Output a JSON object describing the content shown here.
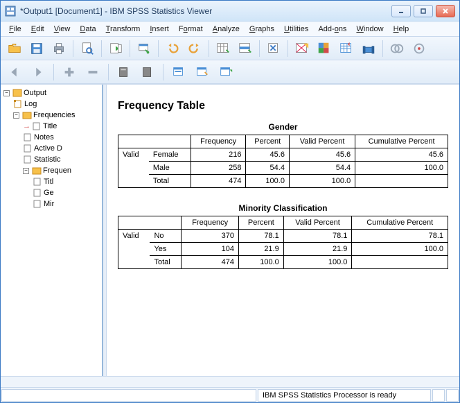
{
  "window": {
    "title": "*Output1 [Document1] - IBM SPSS Statistics Viewer"
  },
  "menu": [
    "File",
    "Edit",
    "View",
    "Data",
    "Transform",
    "Insert",
    "Format",
    "Analyze",
    "Graphs",
    "Utilities",
    "Add-ons",
    "Window",
    "Help"
  ],
  "toolbar1": [
    "open",
    "save",
    "print",
    "preview",
    "export",
    "recall",
    "undo",
    "redo",
    "goto-case",
    "goto-var",
    "variables",
    "find",
    "chart",
    "chart2",
    "weight",
    "select",
    "split",
    "value-labels"
  ],
  "toolbar2": [
    "back",
    "forward",
    "add",
    "remove",
    "collapse",
    "expand",
    "show",
    "hide",
    "pane1",
    "pane2",
    "pane3"
  ],
  "outline": {
    "root": "Output",
    "items": [
      {
        "label": "Log"
      },
      {
        "label": "Frequencies",
        "children": [
          {
            "label": "Title",
            "active": true
          },
          {
            "label": "Notes"
          },
          {
            "label": "Active Dataset"
          },
          {
            "label": "Statistics"
          },
          {
            "label": "Frequency Table",
            "children": [
              {
                "label": "Title"
              },
              {
                "label": "Gender"
              },
              {
                "label": "Minority Classification"
              }
            ]
          }
        ]
      }
    ]
  },
  "content": {
    "heading": "Frequency Table",
    "tables": [
      {
        "title": "Gender",
        "columns": [
          "Frequency",
          "Percent",
          "Valid Percent",
          "Cumulative Percent"
        ],
        "group": "Valid",
        "rows": [
          {
            "label": "Female",
            "cells": [
              "216",
              "45.6",
              "45.6",
              "45.6"
            ]
          },
          {
            "label": "Male",
            "cells": [
              "258",
              "54.4",
              "54.4",
              "100.0"
            ]
          },
          {
            "label": "Total",
            "cells": [
              "474",
              "100.0",
              "100.0",
              ""
            ]
          }
        ]
      },
      {
        "title": "Minority Classification",
        "columns": [
          "Frequency",
          "Percent",
          "Valid Percent",
          "Cumulative Percent"
        ],
        "group": "Valid",
        "rows": [
          {
            "label": "No",
            "cells": [
              "370",
              "78.1",
              "78.1",
              "78.1"
            ]
          },
          {
            "label": "Yes",
            "cells": [
              "104",
              "21.9",
              "21.9",
              "100.0"
            ]
          },
          {
            "label": "Total",
            "cells": [
              "474",
              "100.0",
              "100.0",
              ""
            ]
          }
        ]
      }
    ]
  },
  "status": {
    "processor": "IBM SPSS Statistics Processor is ready"
  }
}
